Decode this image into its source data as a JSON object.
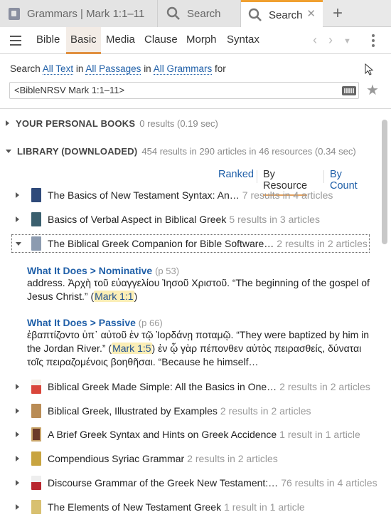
{
  "tabs": [
    {
      "label": "Grammars | Mark 1:1–11",
      "icon": "book-icon"
    },
    {
      "label": "Search",
      "icon": "search-icon"
    },
    {
      "label": "Search",
      "icon": "search-icon"
    }
  ],
  "toolbar": {
    "items": [
      "Bible",
      "Basic",
      "Media",
      "Clause",
      "Morph",
      "Syntax"
    ],
    "active": "Basic"
  },
  "search": {
    "prefix": "Search",
    "scope1": "All Text",
    "in1": "in",
    "scope2": "All Passages",
    "in2": "in",
    "scope3": "All Grammars",
    "for": "for",
    "query": "<BibleNRSV Mark 1:1–11>"
  },
  "sections": {
    "personal": {
      "title": "YOUR PERSONAL BOOKS",
      "meta": "0 results (0.19 sec)"
    },
    "library": {
      "title": "LIBRARY (DOWNLOADED)",
      "meta": "454 results in 290 articles in 46 resources (0.34 sec)"
    }
  },
  "sort": {
    "ranked": "Ranked",
    "by_resource": "By Resource",
    "by_count": "By Count"
  },
  "results": [
    {
      "title": "The Basics of New Testament Syntax: An…",
      "count": "7 results in 4 articles",
      "cover": "#2f4a7a"
    },
    {
      "title": "Basics of Verbal Aspect in Biblical Greek",
      "count": "5 results in 3 articles",
      "cover": "#3a5f6e"
    },
    {
      "title": "The Biblical Greek Companion for Bible Software…",
      "count": "2 results in 2 articles",
      "cover": "#8c9bb0"
    },
    {
      "title": "Biblical Greek Made Simple: All the Basics in One…",
      "count": "2 results in 2 articles",
      "cover": "#d9463a"
    },
    {
      "title": "Biblical Greek, Illustrated by Examples",
      "count": "2 results in 2 articles",
      "cover": "#b98c55"
    },
    {
      "title": "A Brief Greek Syntax and Hints on Greek Accidence",
      "count": "1 result in 1 article",
      "cover": "#6b3a2a"
    },
    {
      "title": "Compendious Syriac Grammar",
      "count": "2 results in 2 articles",
      "cover": "#c8a440"
    },
    {
      "title": "Discourse Grammar of the Greek New Testament:…",
      "count": "76 results in 4 articles",
      "cover": "#b8262e"
    },
    {
      "title": "The Elements of New Testament Greek",
      "count": "1 result in 1 article",
      "cover": "#d8c070"
    }
  ],
  "hits": [
    {
      "title": "What It Does > Nominative",
      "page": "(p 53)",
      "before": "address. Ἀρχὴ τοῦ εὐαγγελίου Ἰησοῦ Χριστοῦ. “The beginning of the gospel of Jesus Christ.” (",
      "ref": "Mark 1:1",
      "after": ")"
    },
    {
      "title": "What It Does > Passive",
      "page": "(p 66)",
      "before": "ἐβαπτίζοντο ὑπ᾽ αὐτοῦ ἐν τῷ Ἰορδάνῃ ποταμῷ. “They were baptized by him in the Jordan River.” (",
      "ref": "Mark 1:5",
      "after": ") ἐν ᾧ γὰρ πέπονθεν αὐτὸς πειρασθείς, δύναται τοῖς πειραζομένοις βοηθῆσαι. “Because he himself…"
    }
  ]
}
